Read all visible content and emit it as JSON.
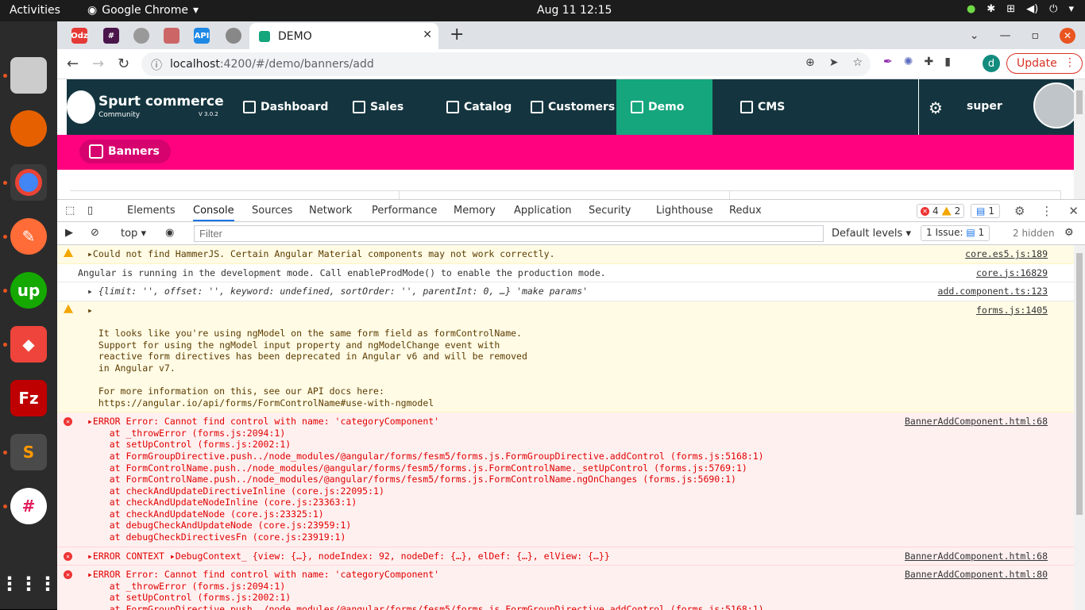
{
  "topbar": {
    "activities": "Activities",
    "app": "Google Chrome",
    "clock": "Aug 11  12:15"
  },
  "tab": {
    "title": "DEMO"
  },
  "pinned_tabs": [
    "Odz",
    "",
    "",
    "",
    "API",
    ""
  ],
  "url": {
    "host": "localhost",
    "rest": ":4200/#/demo/banners/add"
  },
  "profile": {
    "initial": "d",
    "update": "Update"
  },
  "site": {
    "logo": {
      "title": "Spurt commerce",
      "sub": "Community",
      "ver": "V 3.0.2"
    },
    "menu": [
      "Dashboard",
      "Sales",
      "Catalog",
      "Customers",
      "Demo",
      "CMS"
    ],
    "user": "super",
    "crumb": "Banners"
  },
  "devtools": {
    "tabs": [
      "Elements",
      "Console",
      "Sources",
      "Network",
      "Performance",
      "Memory",
      "Application",
      "Security",
      "Lighthouse",
      "Redux"
    ],
    "errors": "4",
    "warnings": "2",
    "messages": "1",
    "context": "top",
    "filter_placeholder": "Filter",
    "levels": "Default levels",
    "issues": "1 Issue:",
    "issues_count": "1",
    "hidden": "2 hidden"
  },
  "console": [
    {
      "type": "warn",
      "text": "▸Could not find HammerJS. Certain Angular Material components may not work correctly.",
      "src": "core.es5.js:189"
    },
    {
      "type": "info",
      "text": "Angular is running in the development mode. Call enableProdMode() to enable the production mode.",
      "src": "core.js:16829"
    },
    {
      "type": "obj",
      "text": "▸ {limit: '', offset: '', keyword: undefined, sortOrder: '', parentInt: 0, …} 'make params'",
      "src": "add.component.ts:123"
    },
    {
      "type": "warn",
      "text": "▸\n\n  It looks like you're using ngModel on the same form field as formControlName.\n  Support for using the ngModel input property and ngModelChange event with\n  reactive form directives has been deprecated in Angular v6 and will be removed\n  in Angular v7.\n\n  For more information on this, see our API docs here:\n  https://angular.io/api/forms/FormControlName#use-with-ngmodel",
      "src": "forms.js:1405"
    },
    {
      "type": "err",
      "text": "▸ERROR Error: Cannot find control with name: 'categoryComponent'\n    at _throwError (forms.js:2094:1)\n    at setUpControl (forms.js:2002:1)\n    at FormGroupDirective.push../node_modules/@angular/forms/fesm5/forms.js.FormGroupDirective.addControl (forms.js:5168:1)\n    at FormControlName.push../node_modules/@angular/forms/fesm5/forms.js.FormControlName._setUpControl (forms.js:5769:1)\n    at FormControlName.push../node_modules/@angular/forms/fesm5/forms.js.FormControlName.ngOnChanges (forms.js:5690:1)\n    at checkAndUpdateDirectiveInline (core.js:22095:1)\n    at checkAndUpdateNodeInline (core.js:23363:1)\n    at checkAndUpdateNode (core.js:23325:1)\n    at debugCheckAndUpdateNode (core.js:23959:1)\n    at debugCheckDirectivesFn (core.js:23919:1)",
      "src": "BannerAddComponent.html:68"
    },
    {
      "type": "err",
      "text": "▸ERROR CONTEXT ▸DebugContext_ {view: {…}, nodeIndex: 92, nodeDef: {…}, elDef: {…}, elView: {…}}",
      "src": "BannerAddComponent.html:68"
    },
    {
      "type": "err",
      "text": "▸ERROR Error: Cannot find control with name: 'categoryComponent'\n    at _throwError (forms.js:2094:1)\n    at setUpControl (forms.js:2002:1)\n    at FormGroupDirective.push../node_modules/@angular/forms/fesm5/forms.js.FormGroupDirective.addControl (forms.js:5168:1)",
      "src": "BannerAddComponent.html:80"
    }
  ]
}
